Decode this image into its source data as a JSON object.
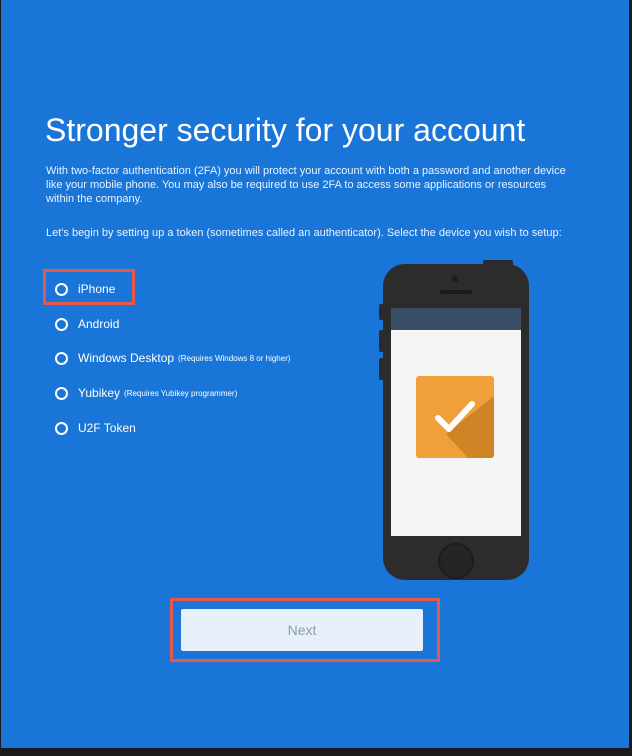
{
  "title": "Stronger security for your account",
  "intro_text": "With two-factor authentication (2FA) you will protect your account with both a password and another device like your mobile phone. You may also be required to use 2FA to access some applications or resources within the company.",
  "prompt_text": "Let's begin by setting up a token (sometimes called an authenticator). Select the device you wish to setup:",
  "options": [
    {
      "label": "iPhone",
      "note": "",
      "selected": false
    },
    {
      "label": "Android",
      "note": "",
      "selected": false
    },
    {
      "label": "Windows Desktop",
      "note": "(Requires Windows 8 or higher)",
      "selected": false
    },
    {
      "label": "Yubikey",
      "note": "(Requires Yubikey programmer)",
      "selected": false
    },
    {
      "label": "U2F Token",
      "note": "",
      "selected": false
    }
  ],
  "next_label": "Next",
  "icons": {
    "radio": "radio-icon",
    "phone": "phone-illustration",
    "check": "checkmark-icon"
  },
  "colors": {
    "background": "#1976d8",
    "highlight": "#e8574c",
    "check_tile": "#f0a03a",
    "phone_body": "#2c2c2c",
    "next_button": "#e8f1fb",
    "next_text": "#8a9bb0"
  }
}
